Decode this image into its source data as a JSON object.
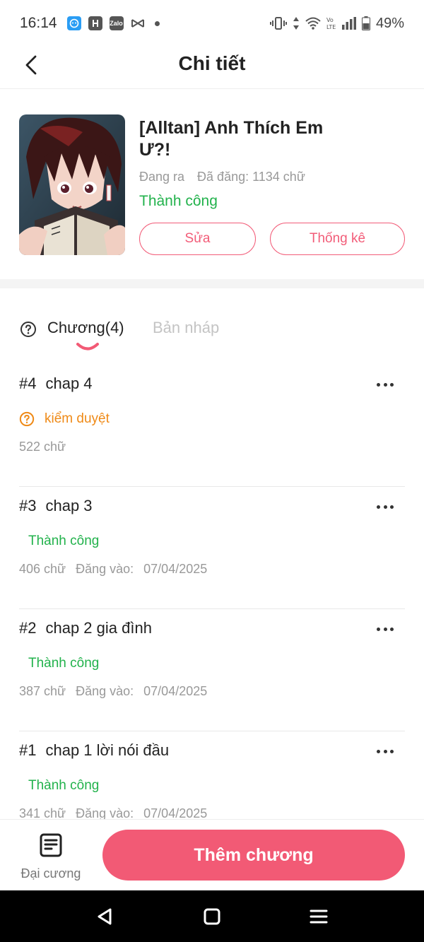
{
  "status_bar": {
    "time": "16:14",
    "battery": "49%",
    "app_icons": [
      "messenger-icon",
      "h-app-icon",
      "zalo-icon",
      "capcut-icon"
    ],
    "zalo_label": "Zalo"
  },
  "header": {
    "title": "Chi tiết"
  },
  "story": {
    "title": "[Alltan] Anh Thích Em Ư?!",
    "status_ongoing": "Đang ra",
    "words_posted": "Đã đăng: 1134 chữ",
    "publish_status": "Thành công",
    "edit_label": "Sửa",
    "stats_label": "Thống kê"
  },
  "tabs": {
    "chapters_label": "Chương(4)",
    "drafts_label": "Bản nháp"
  },
  "chapters": [
    {
      "number": "#4",
      "title": "chap 4",
      "status": "kiểm duyệt",
      "words": "522 chữ"
    },
    {
      "number": "#3",
      "title": "chap 3",
      "status": "Thành công",
      "words": "406 chữ",
      "posted_label": "Đăng vào:",
      "date": "07/04/2025"
    },
    {
      "number": "#2",
      "title": "chap 2 gia đình",
      "status": "Thành công",
      "words": "387 chữ",
      "posted_label": "Đăng vào:",
      "date": "07/04/2025"
    },
    {
      "number": "#1",
      "title": "chap 1 lời nói đầu",
      "status": "Thành công",
      "words": "341 chữ",
      "posted_label": "Đăng vào:",
      "date": "07/04/2025"
    }
  ],
  "bottom": {
    "outline_label": "Đại cương",
    "add_chapter_label": "Thêm chương"
  },
  "colors": {
    "accent": "#f25a75",
    "success": "#22b24c",
    "pending": "#ef8a17"
  }
}
